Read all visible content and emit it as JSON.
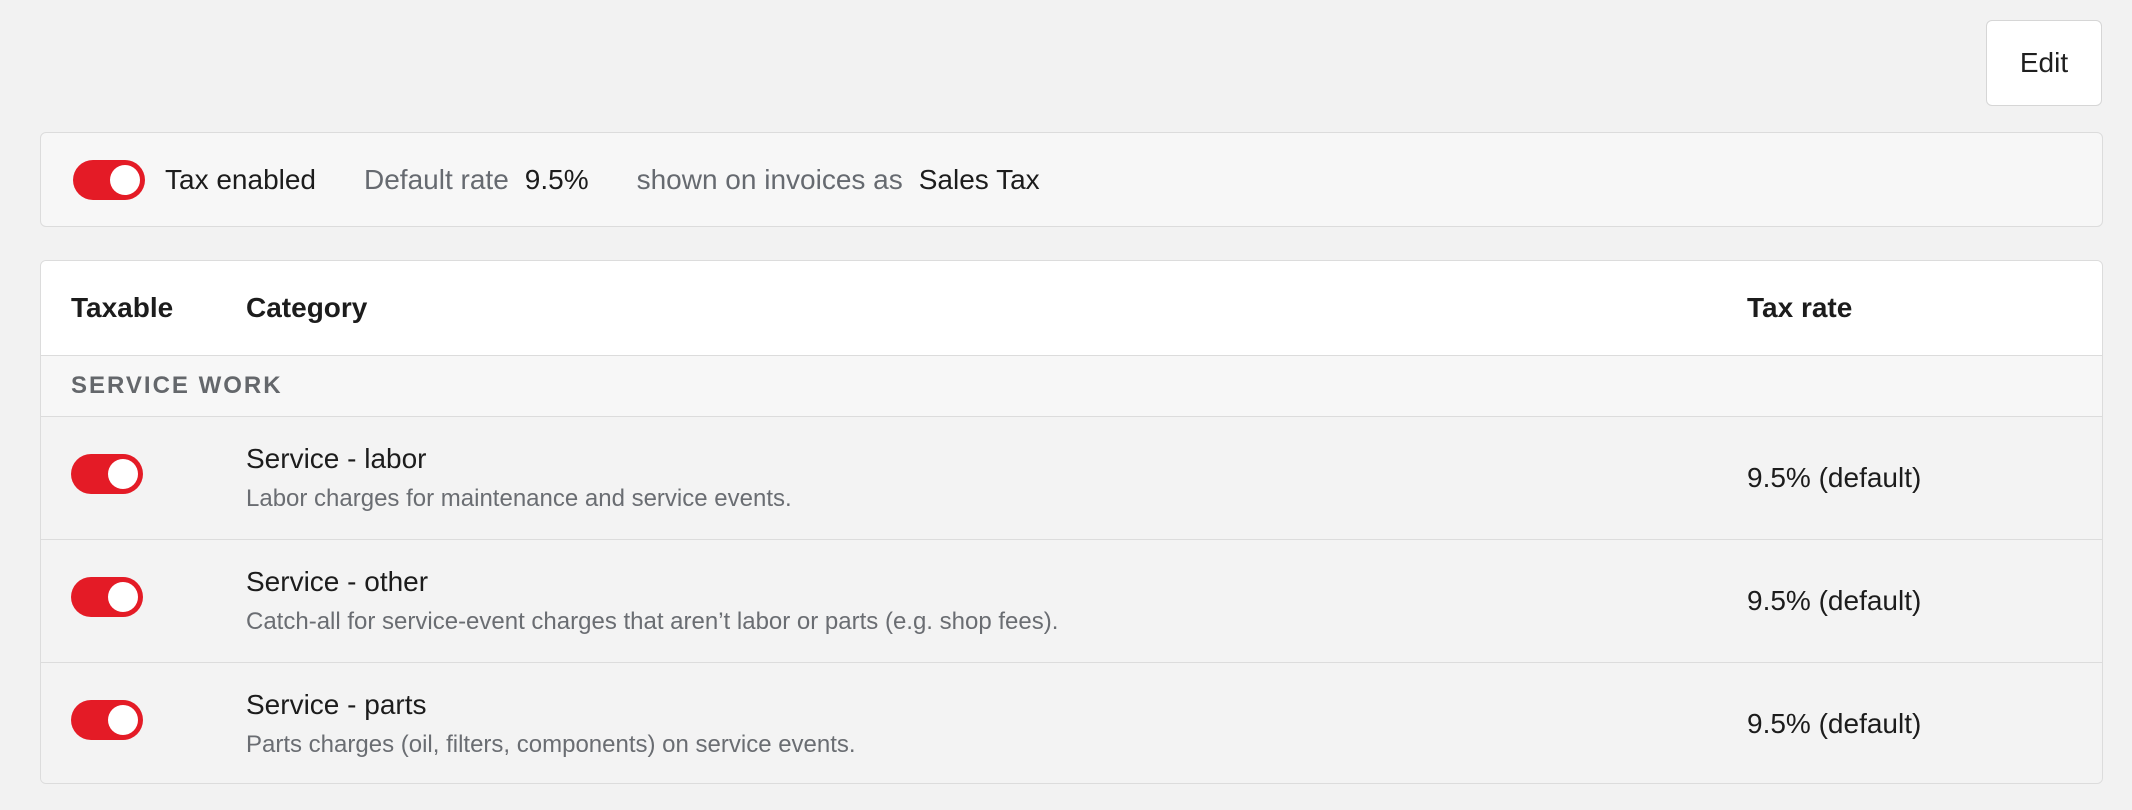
{
  "toolbar": {
    "edit_label": "Edit"
  },
  "summary": {
    "tax_enabled": true,
    "tax_enabled_label": "Tax enabled",
    "default_rate_label": "Default rate",
    "default_rate_value": "9.5%",
    "shown_as_label": "shown on invoices as",
    "shown_as_value": "Sales Tax"
  },
  "table": {
    "headers": {
      "taxable": "Taxable",
      "category": "Category",
      "tax_rate": "Tax rate"
    },
    "section": "SERVICE WORK",
    "rows": [
      {
        "taxable": true,
        "title": "Service - labor",
        "description": "Labor charges for maintenance and service events.",
        "rate": "9.5% (default)"
      },
      {
        "taxable": true,
        "title": "Service - other",
        "description": "Catch-all for service-event charges that aren’t labor or parts (e.g. shop fees).",
        "rate": "9.5% (default)"
      },
      {
        "taxable": true,
        "title": "Service - parts",
        "description": "Parts charges (oil, filters, components) on service events.",
        "rate": "9.5% (default)"
      }
    ]
  },
  "colors": {
    "toggle_on": "#e41b26",
    "background": "#f2f2f2",
    "border": "#dcdcdc"
  }
}
